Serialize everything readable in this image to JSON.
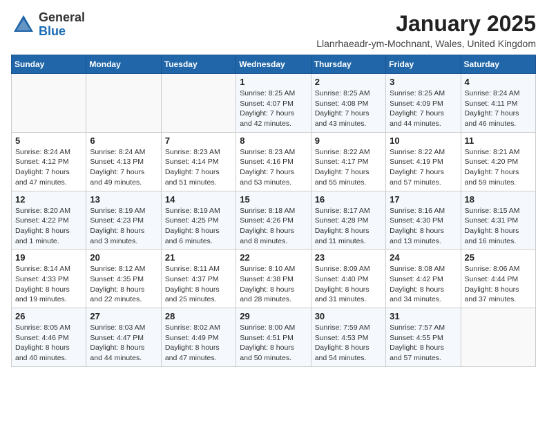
{
  "header": {
    "logo_general": "General",
    "logo_blue": "Blue",
    "month": "January 2025",
    "location": "Llanrhaeadr-ym-Mochnant, Wales, United Kingdom"
  },
  "weekdays": [
    "Sunday",
    "Monday",
    "Tuesday",
    "Wednesday",
    "Thursday",
    "Friday",
    "Saturday"
  ],
  "weeks": [
    [
      {
        "day": "",
        "info": ""
      },
      {
        "day": "",
        "info": ""
      },
      {
        "day": "",
        "info": ""
      },
      {
        "day": "1",
        "info": "Sunrise: 8:25 AM\nSunset: 4:07 PM\nDaylight: 7 hours and 42 minutes."
      },
      {
        "day": "2",
        "info": "Sunrise: 8:25 AM\nSunset: 4:08 PM\nDaylight: 7 hours and 43 minutes."
      },
      {
        "day": "3",
        "info": "Sunrise: 8:25 AM\nSunset: 4:09 PM\nDaylight: 7 hours and 44 minutes."
      },
      {
        "day": "4",
        "info": "Sunrise: 8:24 AM\nSunset: 4:11 PM\nDaylight: 7 hours and 46 minutes."
      }
    ],
    [
      {
        "day": "5",
        "info": "Sunrise: 8:24 AM\nSunset: 4:12 PM\nDaylight: 7 hours and 47 minutes."
      },
      {
        "day": "6",
        "info": "Sunrise: 8:24 AM\nSunset: 4:13 PM\nDaylight: 7 hours and 49 minutes."
      },
      {
        "day": "7",
        "info": "Sunrise: 8:23 AM\nSunset: 4:14 PM\nDaylight: 7 hours and 51 minutes."
      },
      {
        "day": "8",
        "info": "Sunrise: 8:23 AM\nSunset: 4:16 PM\nDaylight: 7 hours and 53 minutes."
      },
      {
        "day": "9",
        "info": "Sunrise: 8:22 AM\nSunset: 4:17 PM\nDaylight: 7 hours and 55 minutes."
      },
      {
        "day": "10",
        "info": "Sunrise: 8:22 AM\nSunset: 4:19 PM\nDaylight: 7 hours and 57 minutes."
      },
      {
        "day": "11",
        "info": "Sunrise: 8:21 AM\nSunset: 4:20 PM\nDaylight: 7 hours and 59 minutes."
      }
    ],
    [
      {
        "day": "12",
        "info": "Sunrise: 8:20 AM\nSunset: 4:22 PM\nDaylight: 8 hours and 1 minute."
      },
      {
        "day": "13",
        "info": "Sunrise: 8:19 AM\nSunset: 4:23 PM\nDaylight: 8 hours and 3 minutes."
      },
      {
        "day": "14",
        "info": "Sunrise: 8:19 AM\nSunset: 4:25 PM\nDaylight: 8 hours and 6 minutes."
      },
      {
        "day": "15",
        "info": "Sunrise: 8:18 AM\nSunset: 4:26 PM\nDaylight: 8 hours and 8 minutes."
      },
      {
        "day": "16",
        "info": "Sunrise: 8:17 AM\nSunset: 4:28 PM\nDaylight: 8 hours and 11 minutes."
      },
      {
        "day": "17",
        "info": "Sunrise: 8:16 AM\nSunset: 4:30 PM\nDaylight: 8 hours and 13 minutes."
      },
      {
        "day": "18",
        "info": "Sunrise: 8:15 AM\nSunset: 4:31 PM\nDaylight: 8 hours and 16 minutes."
      }
    ],
    [
      {
        "day": "19",
        "info": "Sunrise: 8:14 AM\nSunset: 4:33 PM\nDaylight: 8 hours and 19 minutes."
      },
      {
        "day": "20",
        "info": "Sunrise: 8:12 AM\nSunset: 4:35 PM\nDaylight: 8 hours and 22 minutes."
      },
      {
        "day": "21",
        "info": "Sunrise: 8:11 AM\nSunset: 4:37 PM\nDaylight: 8 hours and 25 minutes."
      },
      {
        "day": "22",
        "info": "Sunrise: 8:10 AM\nSunset: 4:38 PM\nDaylight: 8 hours and 28 minutes."
      },
      {
        "day": "23",
        "info": "Sunrise: 8:09 AM\nSunset: 4:40 PM\nDaylight: 8 hours and 31 minutes."
      },
      {
        "day": "24",
        "info": "Sunrise: 8:08 AM\nSunset: 4:42 PM\nDaylight: 8 hours and 34 minutes."
      },
      {
        "day": "25",
        "info": "Sunrise: 8:06 AM\nSunset: 4:44 PM\nDaylight: 8 hours and 37 minutes."
      }
    ],
    [
      {
        "day": "26",
        "info": "Sunrise: 8:05 AM\nSunset: 4:46 PM\nDaylight: 8 hours and 40 minutes."
      },
      {
        "day": "27",
        "info": "Sunrise: 8:03 AM\nSunset: 4:47 PM\nDaylight: 8 hours and 44 minutes."
      },
      {
        "day": "28",
        "info": "Sunrise: 8:02 AM\nSunset: 4:49 PM\nDaylight: 8 hours and 47 minutes."
      },
      {
        "day": "29",
        "info": "Sunrise: 8:00 AM\nSunset: 4:51 PM\nDaylight: 8 hours and 50 minutes."
      },
      {
        "day": "30",
        "info": "Sunrise: 7:59 AM\nSunset: 4:53 PM\nDaylight: 8 hours and 54 minutes."
      },
      {
        "day": "31",
        "info": "Sunrise: 7:57 AM\nSunset: 4:55 PM\nDaylight: 8 hours and 57 minutes."
      },
      {
        "day": "",
        "info": ""
      }
    ]
  ]
}
